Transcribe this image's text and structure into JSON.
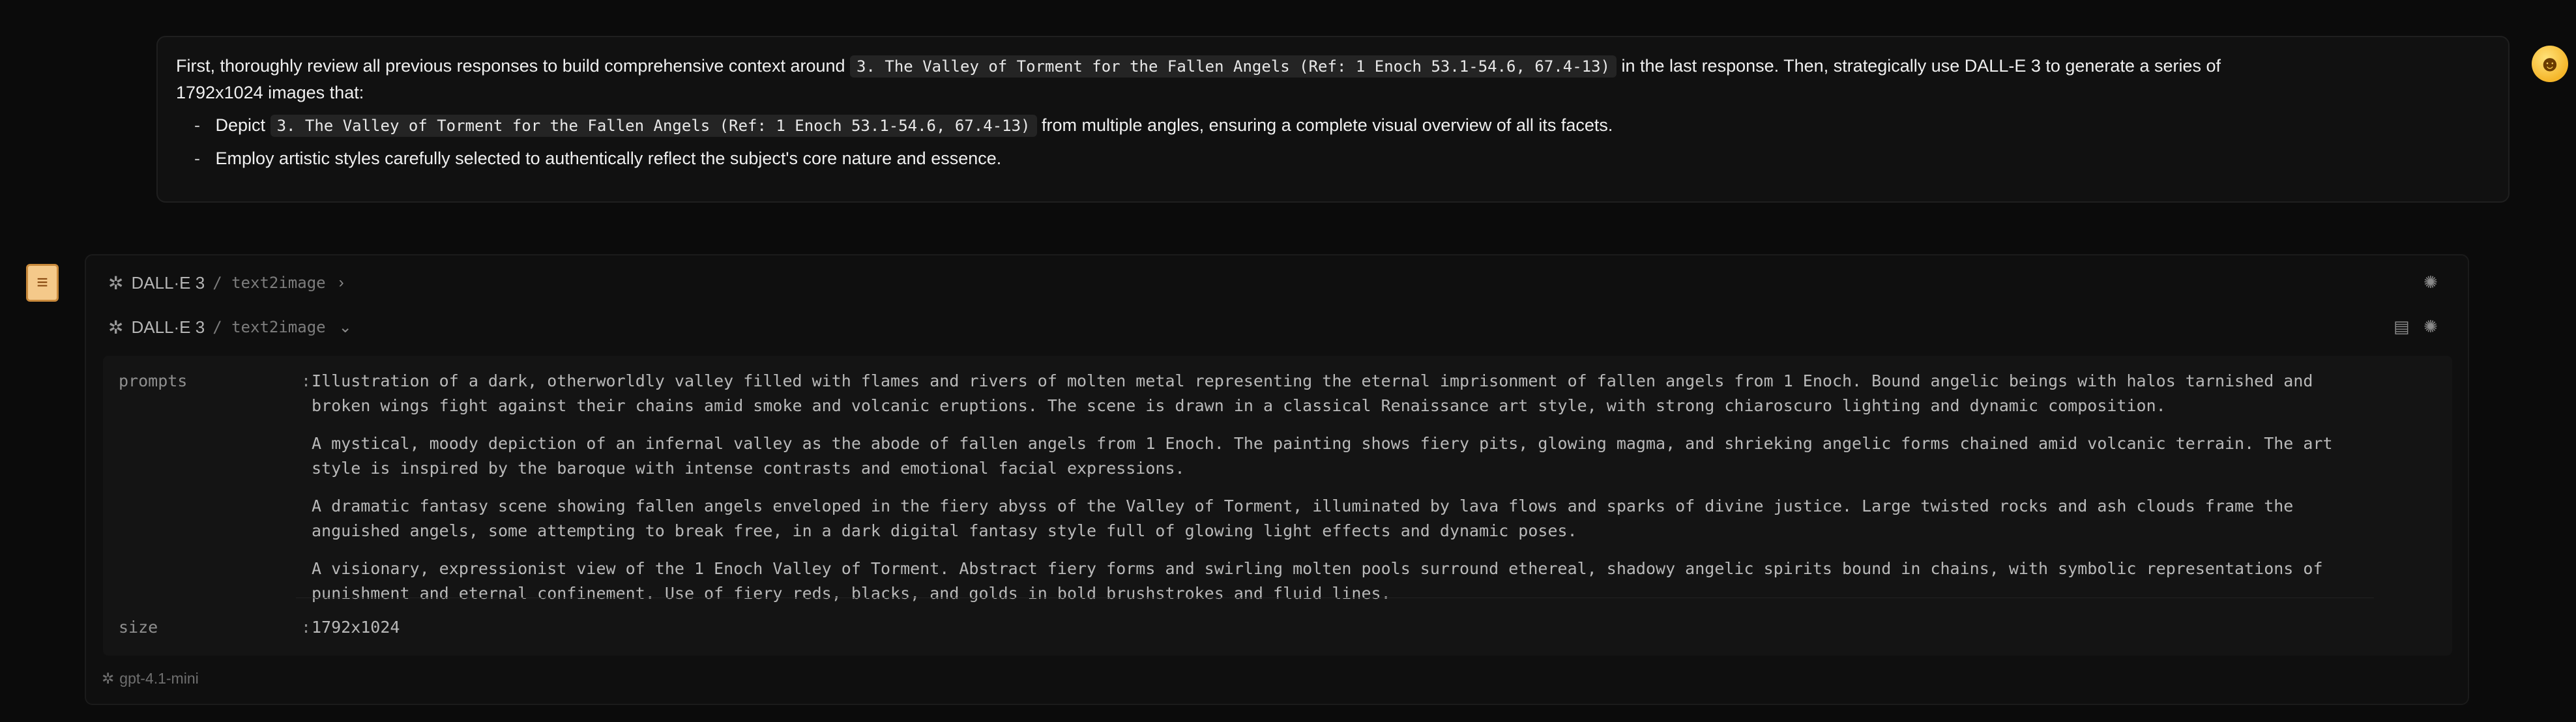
{
  "user_message": {
    "intro_part1": "First, thoroughly review all previous responses to build comprehensive context around",
    "subject_code": "3. The Valley of Torment for the Fallen Angels (Ref: 1 Enoch 53.1-54.6, 67.4-13)",
    "intro_part2": "in the last response. Then, strategically use DALL-E 3 to generate a series of",
    "intro_part3": "1792x1024 images that:",
    "bullet1_prefix": "Depict",
    "bullet1_code": "3. The Valley of Torment for the Fallen Angels (Ref: 1 Enoch 53.1-54.6, 67.4-13)",
    "bullet1_suffix": "from multiple angles, ensuring a complete visual overview of all its facets.",
    "bullet2": "Employ artistic styles carefully selected to authentically reflect the subject's core nature and essence.",
    "dash": "-"
  },
  "user_avatar_icon": "smiley-face-icon",
  "assistant": {
    "avatar_icon": "scroll-icon",
    "tool_collapsed": {
      "name": "DALL·E 3",
      "sub": "/ text2image",
      "chevron": "›"
    },
    "tool_expanded": {
      "name": "DALL·E 3",
      "sub": "/ text2image",
      "chevron": "⌄"
    },
    "params": {
      "prompts_key": "prompts",
      "size_key": "size",
      "colon": ":",
      "prompts": [
        "Illustration of a dark, otherworldly valley filled with flames and rivers of molten metal representing the eternal imprisonment of fallen angels from 1 Enoch. Bound angelic beings with halos tarnished and broken wings fight against their chains amid smoke and volcanic eruptions. The scene is drawn in a classical Renaissance art style, with strong chiaroscuro lighting and dynamic composition.",
        "A mystical, moody depiction of an infernal valley as the abode of fallen angels from 1 Enoch. The painting shows fiery pits, glowing magma, and shrieking angelic forms chained amid volcanic terrain. The art style is inspired by the baroque with intense contrasts and emotional facial expressions.",
        "A dramatic fantasy scene showing fallen angels enveloped in the fiery abyss of the Valley of Torment, illuminated by lava flows and sparks of divine justice. Large twisted rocks and ash clouds frame the anguished angels, some attempting to break free, in a dark digital fantasy style full of glowing light effects and dynamic poses.",
        "A visionary, expressionist view of the 1 Enoch Valley of Torment. Abstract fiery forms and swirling molten pools surround ethereal, shadowy angelic spirits bound in chains, with symbolic representations of punishment and eternal confinement. Use of fiery reds, blacks, and golds in bold brushstrokes and fluid lines."
      ],
      "size": "1792x1024"
    },
    "model": "gpt-4.1-mini"
  },
  "colors": {
    "background": "#0b0b0b",
    "card": "#0f0f0f",
    "code_bg": "#242424"
  }
}
